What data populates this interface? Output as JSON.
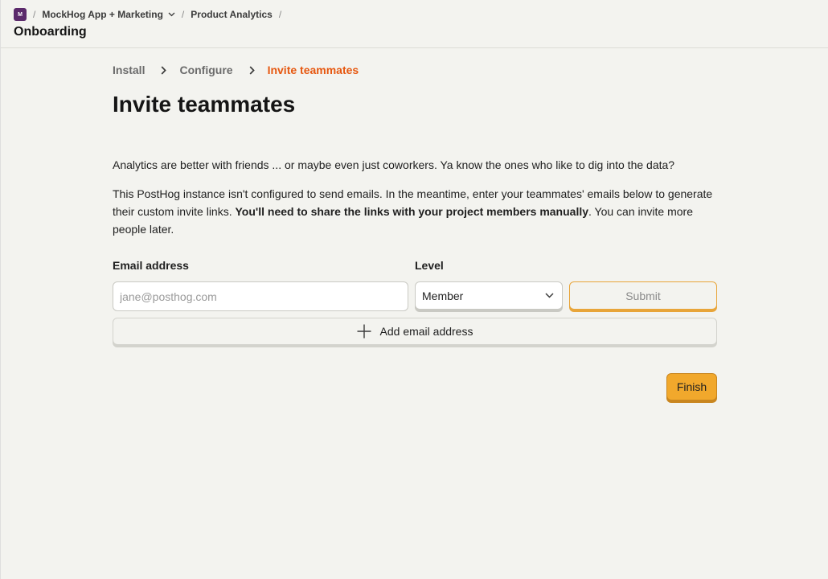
{
  "header": {
    "org_avatar_letter": "M",
    "separator": "/",
    "project": "MockHog App + Marketing",
    "section": "Product Analytics",
    "page_title": "Onboarding"
  },
  "steps": [
    {
      "label": "Install",
      "active": false
    },
    {
      "label": "Configure",
      "active": false
    },
    {
      "label": "Invite teammates",
      "active": true
    }
  ],
  "main": {
    "heading": "Invite teammates",
    "intro": "Analytics are better with friends ... or maybe even just coworkers. Ya know the ones who like to dig into the data?",
    "notice_before": "This PostHog instance isn't configured to send emails. In the meantime, enter your teammates' emails below to generate their custom invite links. ",
    "notice_bold": "You'll need to share the links with your project members manually",
    "notice_after": ". You can invite more people later."
  },
  "form": {
    "email_label": "Email address",
    "email_value": "",
    "email_placeholder": "jane@posthog.com",
    "level_label": "Level",
    "level_value": "Member",
    "submit_label": "Submit",
    "add_label": "Add email address",
    "finish_label": "Finish"
  },
  "colors": {
    "accent": "#e6570f",
    "primary_button": "#f1a82c",
    "avatar": "#5b2a6b",
    "background": "#f3f3ef"
  },
  "icons": {
    "project_dropdown": "chevron-down-icon",
    "step_separator": "chevron-right-icon",
    "level_dropdown": "chevron-down-icon",
    "add": "plus-icon"
  }
}
